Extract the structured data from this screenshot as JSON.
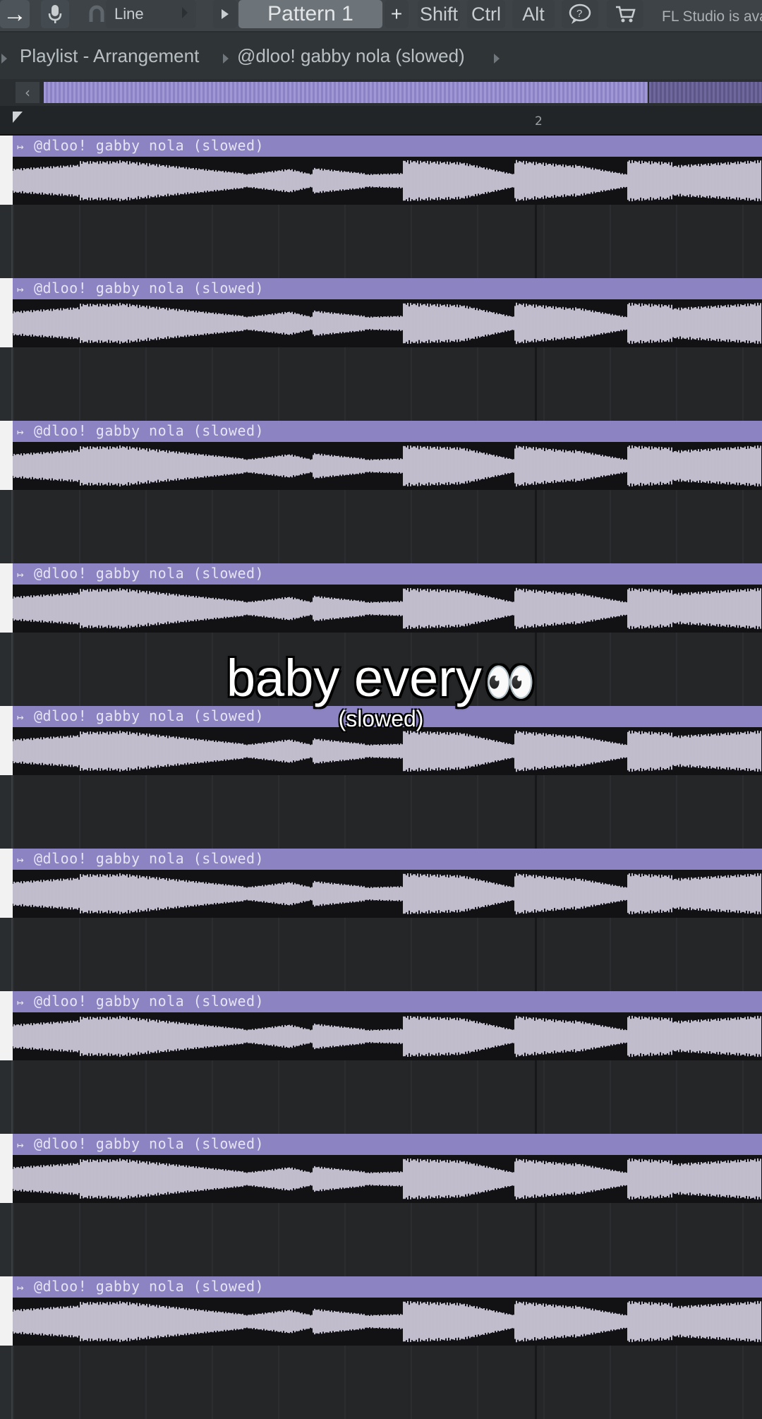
{
  "toolbar": {
    "snap_mode": "Line",
    "pattern": "Pattern 1",
    "add_label": "+",
    "modifiers": [
      "Shift",
      "Ctrl",
      "Alt"
    ],
    "news_text": "FL Studio is ava"
  },
  "breadcrumb": {
    "window": "Playlist - Arrangement",
    "item": "@dloo! gabby nola (slowed)"
  },
  "ruler": {
    "bar_number": "2"
  },
  "clips": [
    {
      "label": "@dloo! gabby nola (slowed)"
    },
    {
      "label": "@dloo! gabby nola (slowed)"
    },
    {
      "label": "@dloo! gabby nola (slowed)"
    },
    {
      "label": "@dloo! gabby nola (slowed)"
    },
    {
      "label": "@dloo! gabby nola (slowed)"
    },
    {
      "label": "@dloo! gabby nola (slowed)"
    },
    {
      "label": "@dloo! gabby nola (slowed)"
    },
    {
      "label": "@dloo! gabby nola (slowed)"
    },
    {
      "label": "@dloo! gabby nola (slowed)"
    }
  ],
  "caption": {
    "main": "baby every",
    "emoji": "👀",
    "sub": "(slowed)"
  },
  "colors": {
    "clip_header": "#8c84c2",
    "waveform": "#ece8fb",
    "background": "#1e1e20"
  }
}
